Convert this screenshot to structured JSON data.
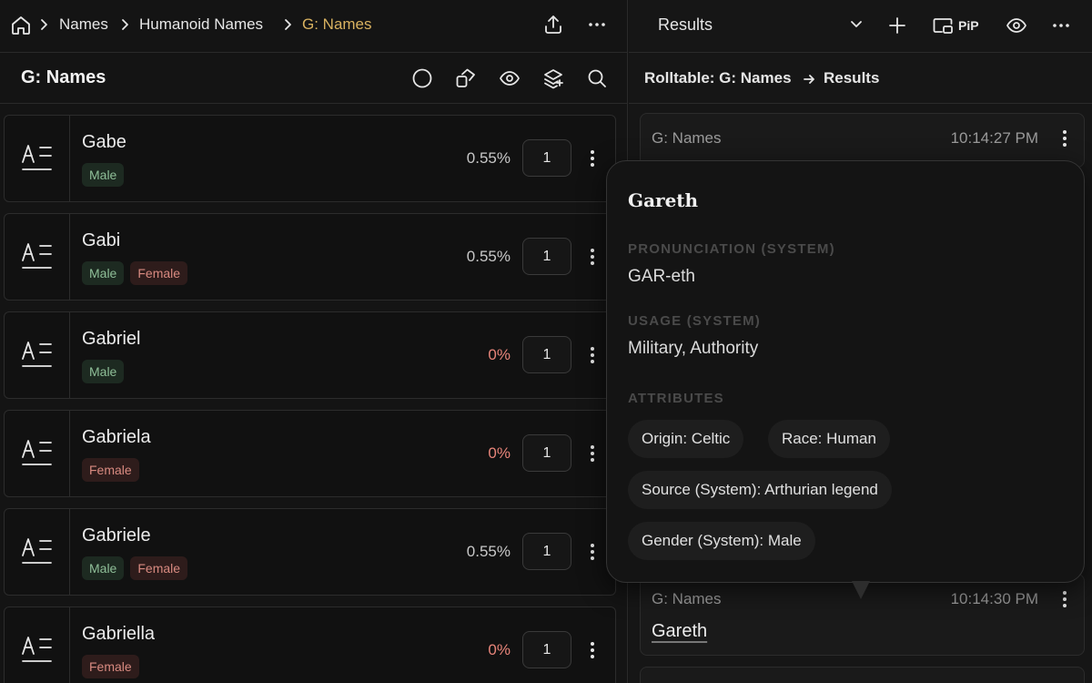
{
  "breadcrumb": {
    "items": [
      "Names",
      "Humanoid Names"
    ],
    "active": "G: Names"
  },
  "left_pane": {
    "title": "G: Names",
    "rows": [
      {
        "name": "Gabe",
        "tags": [
          "Male"
        ],
        "percent": "0.55%",
        "qty": "1"
      },
      {
        "name": "Gabi",
        "tags": [
          "Male",
          "Female"
        ],
        "percent": "0.55%",
        "qty": "1"
      },
      {
        "name": "Gabriel",
        "tags": [
          "Male"
        ],
        "percent": "0%",
        "qty": "1"
      },
      {
        "name": "Gabriela",
        "tags": [
          "Female"
        ],
        "percent": "0%",
        "qty": "1"
      },
      {
        "name": "Gabriele",
        "tags": [
          "Male",
          "Female"
        ],
        "percent": "0.55%",
        "qty": "1"
      },
      {
        "name": "Gabriella",
        "tags": [
          "Female"
        ],
        "percent": "0%",
        "qty": "1"
      }
    ]
  },
  "right_pane": {
    "select_label": "Results",
    "pip_label": "PiP",
    "crumb": {
      "from": "Rolltable: G: Names",
      "to": "Results"
    },
    "results": [
      {
        "source": "G: Names",
        "time": "10:14:27 PM"
      },
      {
        "source": "G: Names",
        "time": "10:14:30 PM",
        "value": "Gareth"
      }
    ]
  },
  "popover": {
    "title": "Gareth",
    "pronunciation_label": "PRONUNCIATION (SYSTEM)",
    "pronunciation": "GAR-eth",
    "usage_label": "USAGE (SYSTEM)",
    "usage": "Military, Authority",
    "attributes_label": "ATTRIBUTES",
    "attributes": [
      "Origin: Celtic",
      "Race: Human",
      "Source (System): Arthurian legend",
      "Gender (System): Male"
    ]
  },
  "colors": {
    "accent": "#d9b260",
    "male_tag_bg": "#1d2a21",
    "female_tag_bg": "#2e1c1b",
    "zero_percent": "#e8857a"
  }
}
